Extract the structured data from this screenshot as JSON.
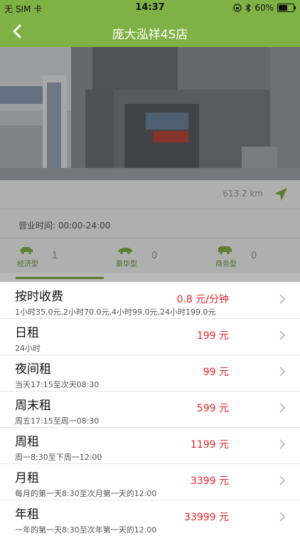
{
  "status_bar": {
    "carrier": "无 SIM 卡",
    "time": "14:37",
    "battery": "60%",
    "battery_level": 0.6
  },
  "nav": {
    "title": "庞大泓祥4S店"
  },
  "store": {
    "distance": "613.2 km",
    "hours": "营业时间:  00:00-24:00",
    "vehicle_types": [
      {
        "label": "经济型",
        "count": "1"
      },
      {
        "label": "豪华型",
        "count": "0"
      },
      {
        "label": "商务型",
        "count": "0"
      }
    ]
  },
  "prices": [
    {
      "name": "按时收费",
      "desc": "1小时35.0元,2小时70.0元,4小时99.0元,24小时199.0元",
      "price": "0.8 元/分钟"
    },
    {
      "name": "日租",
      "desc": "24小时",
      "price": "199 元"
    },
    {
      "name": "夜间租",
      "desc": "当天17:15至次天08:30",
      "price": "99 元"
    },
    {
      "name": "周末租",
      "desc": "周五17:15至周一08:30",
      "price": "599 元"
    },
    {
      "name": "周租",
      "desc": "周一8:30至下周一12:00",
      "price": "1199 元"
    },
    {
      "name": "月租",
      "desc": "每月的第一天8:30至次月第一天的12:00",
      "price": "3399 元"
    },
    {
      "name": "年租",
      "desc": "一年的第一天8:30至次年第一天的12:00",
      "price": "33999 元"
    }
  ],
  "colors": {
    "brand_green": "#7fb245",
    "price_red": "#e2252b"
  }
}
